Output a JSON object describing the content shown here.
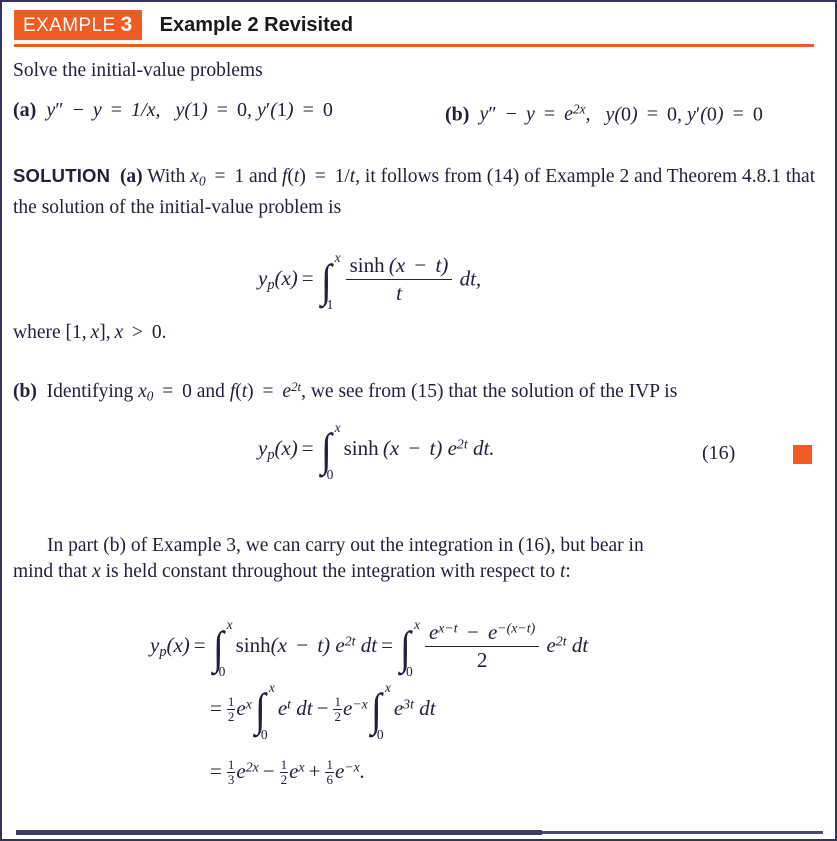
{
  "page": {
    "border_color": "#33335c",
    "background": "#ffffff"
  },
  "header": {
    "badge_label": "EXAMPLE",
    "badge_number": "3",
    "badge_color": "#ee5b23",
    "title": "Example 2 Revisited",
    "rule_color": "#ee5b23"
  },
  "body": {
    "intro": "Solve the initial-value problems",
    "problem_a": {
      "label": "(a)",
      "equation": "y″ − y = 1/x,",
      "conditions": "y(1) = 0, y′(1) = 0"
    },
    "problem_b": {
      "label": "(b)",
      "equation": "y″ − y = e^{2x},",
      "conditions": "y(0) = 0, y′(0) = 0"
    },
    "solution_label": "SOLUTION",
    "solution_a_line1": "(a) With x₀ = 1 and f(t) = 1/t, it follows from (14) of Example 2 and",
    "solution_a_line2": "Theorem 4.8.1 that the solution of the initial-value problem is",
    "where_line": "where [1, x], x > 0.",
    "solution_b_line": "(b) Identifying x₀ = 0 and f(t) = e^{2t}, we see from (15) that the solution of the IVP is",
    "closing_line1": "In part (b) of Example 3, we can carry out the integration in (16), but bear in",
    "closing_line2": "mind that x is held constant throughout the integration with respect to t:"
  },
  "equations": {
    "eq_a": {
      "lhs": "yₚ(x) =",
      "integral_lower": "1",
      "integral_upper": "x",
      "numerator": "sinh (x − t)",
      "denominator": "t",
      "differential": "dt,"
    },
    "eq_16": {
      "lhs": "yₚ(x) =",
      "integral_lower": "0",
      "integral_upper": "x",
      "integrand": "sinh (x − t) e^{2t} dt.",
      "number": "(16)",
      "endmark_color": "#ee5b23"
    },
    "derivation": {
      "line1_lhs": "yₚ(x) =",
      "line1_int1_lower": "0",
      "line1_int1_upper": "x",
      "line1_int1_body": "sinh(x − t) e^{2t} dt =",
      "line1_int2_lower": "0",
      "line1_int2_upper": "x",
      "line1_numerator": "e^{x−t} − e^{−(x−t)}",
      "line1_denominator": "2",
      "line1_tail": "e^{2t} dt",
      "line2": "= ½ e^x ∫₀ˣ e^t dt − ½ e^{−x} ∫₀ˣ e^{3t} dt",
      "line2_frac1": "1/2",
      "line2_frac2": "1/2",
      "line3": "= ⅓ e^{2x} − ½ e^x + ⅙ e^{−x}.",
      "line3_frac1": "1/3",
      "line3_frac2": "1/2",
      "line3_frac3": "1/6"
    }
  },
  "symbols": {
    "integral": "∫",
    "minus": "−",
    "equals": "=",
    "greater_than": ">"
  }
}
